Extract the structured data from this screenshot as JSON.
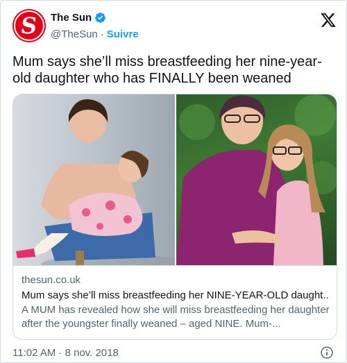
{
  "account": {
    "display_name": "The Sun",
    "handle": "@TheSun",
    "separator": "·",
    "follow_label": "Suivre",
    "avatar_letter": "S",
    "avatar_icon": "the-sun-logo",
    "verified_icon": "verified-badge-icon"
  },
  "header": {
    "close_icon": "x-logo-icon"
  },
  "tweet": {
    "text": "Mum says she’ll miss breastfeeding her nine-year-old daughter who has FINALLY been weaned"
  },
  "card": {
    "domain": "thesun.co.uk",
    "title": "Mum says she’ll miss breastfeeding her NINE-YEAR-OLD daught...",
    "description": "A MUM has revealed how she will miss breastfeeding her daughter after the youngster finally weaned – aged NINE. Mum-...",
    "images": [
      "photo-mother-breastfeeding-daughter",
      "photo-mother-hugging-daughter"
    ]
  },
  "meta": {
    "timestamp": "11:02 AM · 8 nov. 2018",
    "info_icon": "info-icon"
  },
  "colors": {
    "brand_red": "#e2001a",
    "link_blue": "#1d9bf0",
    "text_primary": "#0f1419",
    "text_secondary": "#536471",
    "border": "#cfd9de"
  }
}
